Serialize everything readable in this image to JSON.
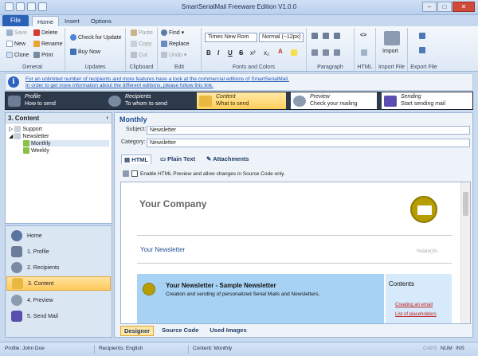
{
  "window": {
    "title": "SmartSerialMail Freeware Edition V1.0.0",
    "buttons": [
      "–",
      "□",
      "✕"
    ]
  },
  "ribbon_tabs": [
    "File",
    "Home",
    "Insert",
    "Options"
  ],
  "ribbon": {
    "general": {
      "label": "General",
      "save": "Save",
      "new": "New",
      "clone": "Clone",
      "delete": "Delete",
      "rename": "Rename",
      "print": "Print"
    },
    "updates": {
      "label": "Updates",
      "check": "Check for Update",
      "buy": "Buy Now"
    },
    "clipboard": {
      "label": "Clipboard",
      "paste": "Paste",
      "copy": "Copy",
      "cut": "Cut"
    },
    "edit": {
      "label": "Edit",
      "find": "Find",
      "replace": "Replace",
      "undo": "Undo"
    },
    "font": {
      "label": "Fonts and Colors",
      "family": "Times New Rom",
      "size": "Normal (~12px)",
      "bold": "B",
      "italic": "I",
      "underline": "U",
      "strike": "S",
      "sup": "x²",
      "sub": "x₂",
      "color": "A"
    },
    "paragraph": {
      "label": "Paragraph"
    },
    "html": {
      "label": "HTML"
    },
    "import_file": {
      "label": "Import File",
      "import": "Import"
    },
    "export_file": {
      "label": "Export File"
    }
  },
  "info": {
    "line1": "For an unlimited number of recipients and more features have a look at the commercial editions of SmartSerialMail.",
    "line2": "In order to get more information about the different editions, please follow this link."
  },
  "wizard": [
    {
      "name": "Profile",
      "desc": "How to send"
    },
    {
      "name": "Recipients",
      "desc": "To whom to send"
    },
    {
      "name": "Content",
      "desc": "What to send"
    },
    {
      "name": "Preview",
      "desc": "Check your mailing"
    },
    {
      "name": "Sending",
      "desc": "Start sending mail"
    }
  ],
  "tree": {
    "header": "3. Content",
    "collapse": "‹",
    "items": [
      "Support",
      "Newsletter",
      "Monthly",
      "Weekly"
    ]
  },
  "nav": [
    "Home",
    "1. Profile",
    "2. Recipients",
    "3. Content",
    "4. Preview",
    "5. Send Mail"
  ],
  "content": {
    "title": "Monthly",
    "subject_label": "Subject:",
    "subject_value": "Newsletter",
    "category_label": "Category:",
    "category_value": "Newsletter",
    "tabs": [
      "HTML",
      "Plain Text",
      "Attachments"
    ],
    "check_label": "Enable HTML Preview and allow changes in Source Code only.",
    "bottom_tabs": [
      "Designer",
      "Source Code",
      "Used Images"
    ]
  },
  "preview": {
    "company": "Your Company",
    "newsletter": "Your Newsletter",
    "date_token": "%date()%",
    "banner_title": "Your Newsletter - Sample Newsletter",
    "banner_sub": "Creation and sending of personalized Serial Mails and Newsletters.",
    "contents_title": "Contents",
    "contents_links": [
      "Creating an email",
      "List of placeholders"
    ]
  },
  "status": {
    "profile": "Profile: John Doe",
    "recipients": "Recipients: English",
    "content": "Content: Monthly",
    "caps": "CAPS",
    "num": "NUM",
    "ins": "INS"
  },
  "colors": {
    "accent": "#2a62b8",
    "active_step": "#ffce5b",
    "link": "#1a55b8"
  }
}
